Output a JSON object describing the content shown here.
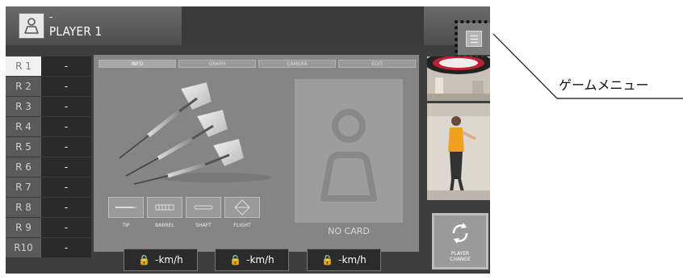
{
  "player": {
    "dash": "-",
    "name": "PLAYER 1"
  },
  "rounds": [
    {
      "label": "R 1",
      "value": "-"
    },
    {
      "label": "R 2",
      "value": "-"
    },
    {
      "label": "R 3",
      "value": "-"
    },
    {
      "label": "R 4",
      "value": "-"
    },
    {
      "label": "R 5",
      "value": "-"
    },
    {
      "label": "R 6",
      "value": "-"
    },
    {
      "label": "R 7",
      "value": "-"
    },
    {
      "label": "R 8",
      "value": "-"
    },
    {
      "label": "R 9",
      "value": "-"
    },
    {
      "label": "R10",
      "value": "-"
    }
  ],
  "tabs": [
    "INFO",
    "GRAPH",
    "CAMERA",
    "EDIT"
  ],
  "parts": [
    "TIP",
    "BARREL",
    "SHAFT",
    "FLIGHT"
  ],
  "card": {
    "label": "NO CARD"
  },
  "speeds": [
    "-km/h",
    "-km/h",
    "-km/h"
  ],
  "change_button": {
    "line1": "PLAYER",
    "line2": "CHANGE"
  },
  "callout": {
    "label": "ゲームメニュー"
  }
}
